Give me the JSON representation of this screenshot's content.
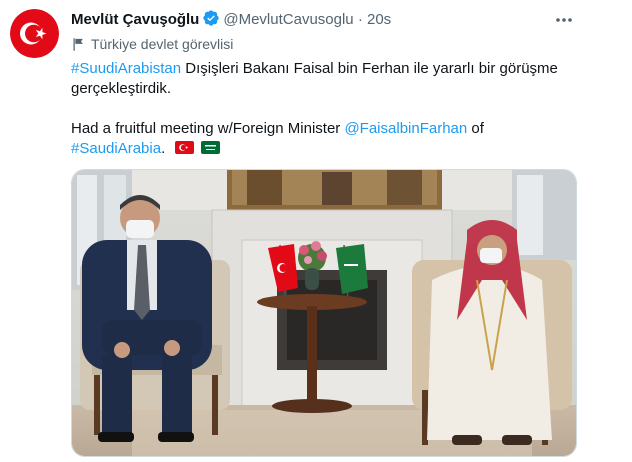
{
  "tweet": {
    "display_name": "Mevlüt Çavuşoğlu",
    "handle": "@MevlutCavusoglu",
    "separator": "·",
    "time": "20s",
    "more_icon": "more-horizontal-icon",
    "govt_label": "Türkiye devlet görevlisi",
    "line1_hashtag": "#SuudiArabistan",
    "line1_text": " Dışişleri Bakanı Faisal bin Ferhan ile yararlı  bir görüşme",
    "line2_text": "gerçekleştirdik.",
    "line3_text": "Had a fruitful meeting w/Foreign Minister ",
    "line3_mention": "@FaisalbinFarhan",
    "line3_tail": " of",
    "line4_hashtag": "#SaudiArabia",
    "line4_tail": ".",
    "flag_icons": [
      "turkey-flag-icon",
      "saudi-flag-icon"
    ]
  },
  "colors": {
    "link": "#1d9bf0",
    "secondary": "#536471",
    "verified": "#1d9bf0",
    "turkey_red": "#e30a17",
    "saudi_green": "#006c35"
  }
}
